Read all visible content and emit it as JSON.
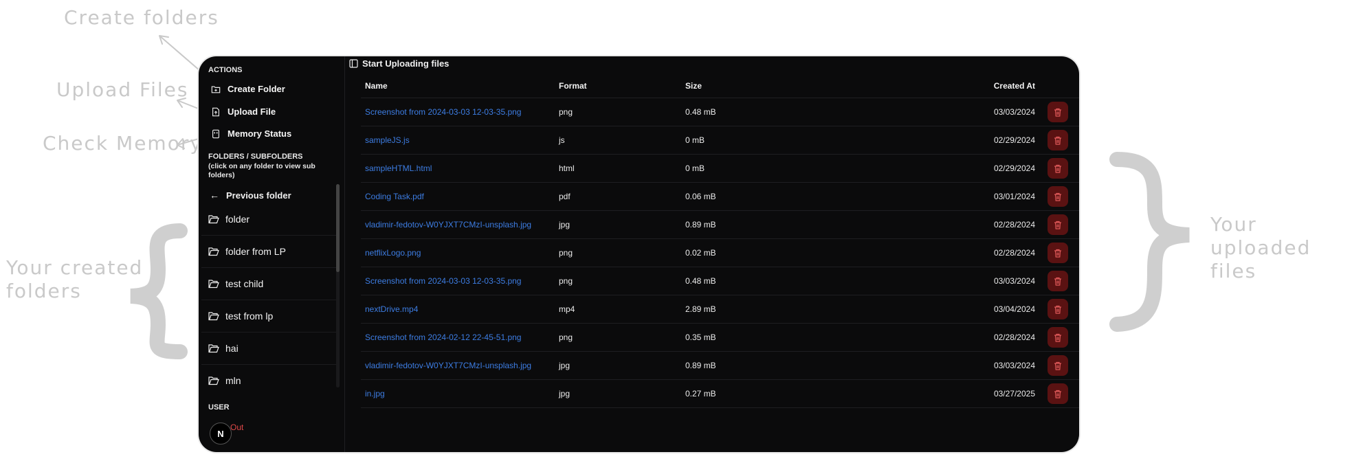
{
  "annotations": {
    "create_folders": "Create folders",
    "upload_files": "Upload Files",
    "check_memory": "Check Memory",
    "your_created_folders": "Your created\nfolders",
    "your_uploaded_files": "Your uploaded\nfiles"
  },
  "sidebar": {
    "actions_label": "ACTIONS",
    "actions": [
      {
        "label": "Create Folder",
        "icon": "folder-plus-icon"
      },
      {
        "label": "Upload File",
        "icon": "file-upload-icon"
      },
      {
        "label": "Memory Status",
        "icon": "memory-icon"
      }
    ],
    "folders_label": "FOLDERS / SUBFOLDERS",
    "folders_hint": "(click on any folder to view sub folders)",
    "previous_folder": "Previous folder",
    "folders": [
      "folder",
      "folder from LP",
      "test child",
      "test from lp",
      "hai",
      "mln"
    ],
    "user_label": "USER",
    "signout_label": "Out",
    "avatar_letter": "N"
  },
  "main": {
    "header_title": "Start Uploading files",
    "columns": {
      "name": "Name",
      "format": "Format",
      "size": "Size",
      "created": "Created At"
    },
    "files": [
      {
        "name": "Screenshot from 2024-03-03 12-03-35.png",
        "format": "png",
        "size": "0.48 mB",
        "created": "03/03/2024"
      },
      {
        "name": "sampleJS.js",
        "format": "js",
        "size": "0 mB",
        "created": "02/29/2024"
      },
      {
        "name": "sampleHTML.html",
        "format": "html",
        "size": "0 mB",
        "created": "02/29/2024"
      },
      {
        "name": "Coding Task.pdf",
        "format": "pdf",
        "size": "0.06 mB",
        "created": "03/01/2024"
      },
      {
        "name": "vladimir-fedotov-W0YJXT7CMzI-unsplash.jpg",
        "format": "jpg",
        "size": "0.89 mB",
        "created": "02/28/2024"
      },
      {
        "name": "netflixLogo.png",
        "format": "png",
        "size": "0.02 mB",
        "created": "02/28/2024"
      },
      {
        "name": "Screenshot from 2024-03-03 12-03-35.png",
        "format": "png",
        "size": "0.48 mB",
        "created": "03/03/2024"
      },
      {
        "name": "nextDrive.mp4",
        "format": "mp4",
        "size": "2.89 mB",
        "created": "03/04/2024"
      },
      {
        "name": "Screenshot from 2024-02-12 22-45-51.png",
        "format": "png",
        "size": "0.35 mB",
        "created": "02/28/2024"
      },
      {
        "name": "vladimir-fedotov-W0YJXT7CMzI-unsplash.jpg",
        "format": "jpg",
        "size": "0.89 mB",
        "created": "03/03/2024"
      },
      {
        "name": "in.jpg",
        "format": "jpg",
        "size": "0.27 mB",
        "created": "03/27/2025"
      }
    ]
  },
  "colors": {
    "background": "#0b0b0c",
    "link": "#3d7de3",
    "delete_bg": "#5a1212",
    "delete_icon": "#e05a5a",
    "annotation": "#c9c9c9"
  }
}
